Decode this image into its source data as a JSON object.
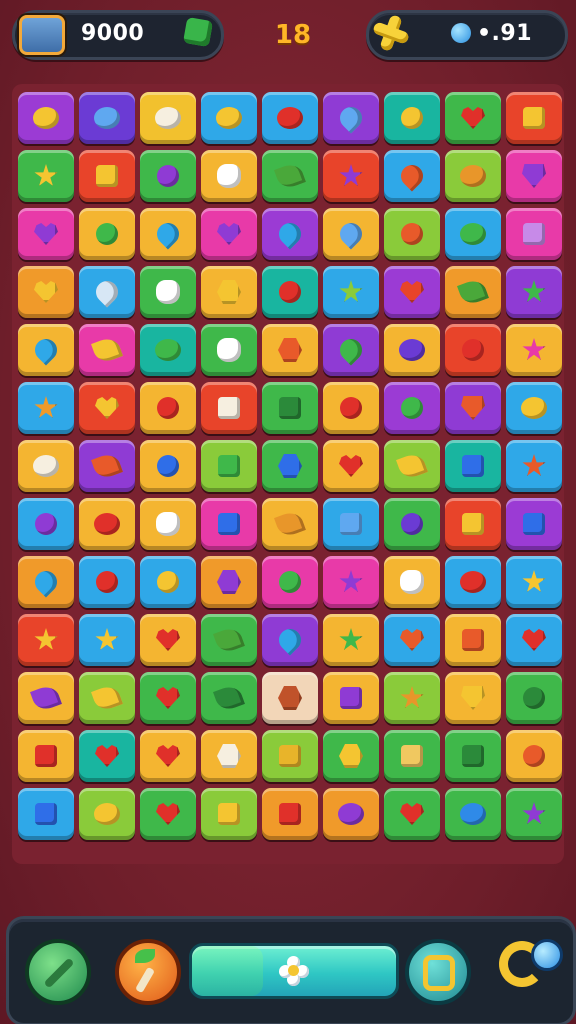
{
  "hud": {
    "score": "9000",
    "moves": "18",
    "gems": "•.91"
  },
  "board": {
    "rows": [
      [
        [
          "#9b3bd4",
          "#f4c531",
          "oval"
        ],
        [
          "#6b3bd4",
          "#5fa8f0",
          "oval"
        ],
        [
          "#f2c12e",
          "#f6efe0",
          "oval"
        ],
        [
          "#2fa8e8",
          "#f4c531",
          "oval"
        ],
        [
          "#2fa8e8",
          "#e0302a",
          "oval"
        ],
        [
          "#8f3bd4",
          "#5fa8f0",
          "drop"
        ],
        [
          "#19b5a0",
          "#f4c531",
          "round"
        ],
        [
          "#3fb84a",
          "#e0302a",
          "heart"
        ],
        [
          "#e8442a",
          "#f4c531",
          "square"
        ]
      ],
      [
        [
          "#3fb84a",
          "#f4c531",
          "star"
        ],
        [
          "#e8442a",
          "#f4c531",
          "square"
        ],
        [
          "#3fb84a",
          "#8f3bd4",
          "round"
        ],
        [
          "#f4b531",
          "#ffffff",
          "face"
        ],
        [
          "#3fb84a",
          "#4aa83a",
          "leaf"
        ],
        [
          "#e8442a",
          "#8f3bd4",
          "star"
        ],
        [
          "#2fa8e8",
          "#e85a2a",
          "drop"
        ],
        [
          "#8acb3a",
          "#e8962a",
          "oval"
        ],
        [
          "#e83aa8",
          "#8f3bd4",
          "shield"
        ]
      ],
      [
        [
          "#e83aa8",
          "#8f3bd4",
          "heart"
        ],
        [
          "#f4b531",
          "#3fb84a",
          "round"
        ],
        [
          "#f4b531",
          "#2fa8e8",
          "drop"
        ],
        [
          "#e83aa8",
          "#8f3bd4",
          "heart"
        ],
        [
          "#9b3bd4",
          "#2fa8e8",
          "drop"
        ],
        [
          "#f4b531",
          "#5fa8f0",
          "drop"
        ],
        [
          "#8acb3a",
          "#e85a2a",
          "round"
        ],
        [
          "#2fa8e8",
          "#3fb84a",
          "oval"
        ],
        [
          "#e83aa8",
          "#c78ae8",
          "square"
        ]
      ],
      [
        [
          "#f09a2a",
          "#f4c531",
          "heart"
        ],
        [
          "#2fa8e8",
          "#d7e7f5",
          "drop"
        ],
        [
          "#3fb84a",
          "#ffffff",
          "face"
        ],
        [
          "#f4b531",
          "#f4c531",
          "hex"
        ],
        [
          "#19b5a0",
          "#e0302a",
          "round"
        ],
        [
          "#2fa8e8",
          "#8acb3a",
          "star"
        ],
        [
          "#9b3bd4",
          "#e8442a",
          "heart"
        ],
        [
          "#f09a2a",
          "#4aa83a",
          "leaf"
        ],
        [
          "#8f3bd4",
          "#3fb84a",
          "star"
        ]
      ],
      [
        [
          "#f4b531",
          "#2fa8e8",
          "drop"
        ],
        [
          "#e83aa8",
          "#f4c531",
          "leaf"
        ],
        [
          "#19b5a0",
          "#3fb84a",
          "oval"
        ],
        [
          "#3fb84a",
          "#ffffff",
          "face"
        ],
        [
          "#f4b531",
          "#e85a2a",
          "hex"
        ],
        [
          "#8f3bd4",
          "#3fb84a",
          "drop"
        ],
        [
          "#f4b531",
          "#6b3bd4",
          "oval"
        ],
        [
          "#e8442a",
          "#e0302a",
          "round"
        ],
        [
          "#f4b531",
          "#e83aa8",
          "star"
        ]
      ],
      [
        [
          "#2fa8e8",
          "#f09a2a",
          "star"
        ],
        [
          "#e8442a",
          "#f4c531",
          "heart"
        ],
        [
          "#f4b531",
          "#e0302a",
          "round"
        ],
        [
          "#e8442a",
          "#f6efe0",
          "square"
        ],
        [
          "#3fb84a",
          "#2b8a3a",
          "square"
        ],
        [
          "#f4b531",
          "#e0302a",
          "round"
        ],
        [
          "#9b3bd4",
          "#3fb84a",
          "round"
        ],
        [
          "#8f3bd4",
          "#e85a2a",
          "shield"
        ],
        [
          "#2fa8e8",
          "#f4c531",
          "oval"
        ]
      ],
      [
        [
          "#f4b531",
          "#f6efe0",
          "oval"
        ],
        [
          "#8f3bd4",
          "#e85a2a",
          "leaf"
        ],
        [
          "#f4b531",
          "#2f6ee8",
          "round"
        ],
        [
          "#8acb3a",
          "#3fb84a",
          "square"
        ],
        [
          "#3fb84a",
          "#2f6ee8",
          "hex"
        ],
        [
          "#f4b531",
          "#e0302a",
          "heart"
        ],
        [
          "#8acb3a",
          "#f4c531",
          "leaf"
        ],
        [
          "#19b5a0",
          "#2f6ee8",
          "square"
        ],
        [
          "#2fa8e8",
          "#e85a2a",
          "star"
        ]
      ],
      [
        [
          "#2fa8e8",
          "#8f3bd4",
          "round"
        ],
        [
          "#f4b531",
          "#e0302a",
          "oval"
        ],
        [
          "#f4b531",
          "#ffffff",
          "face"
        ],
        [
          "#e83aa8",
          "#2f6ee8",
          "square"
        ],
        [
          "#f4b531",
          "#e8962a",
          "leaf"
        ],
        [
          "#2fa8e8",
          "#5fa8f0",
          "square"
        ],
        [
          "#3fb84a",
          "#6b3bd4",
          "round"
        ],
        [
          "#e8442a",
          "#f4c531",
          "square"
        ],
        [
          "#9b3bd4",
          "#2f6ee8",
          "square"
        ]
      ],
      [
        [
          "#f09a2a",
          "#2fa8e8",
          "drop"
        ],
        [
          "#2fa8e8",
          "#e0302a",
          "round"
        ],
        [
          "#2fa8e8",
          "#f4c531",
          "round"
        ],
        [
          "#f09a2a",
          "#8f3bd4",
          "hex"
        ],
        [
          "#e83aa8",
          "#3fb84a",
          "round"
        ],
        [
          "#e83aa8",
          "#8f3bd4",
          "star"
        ],
        [
          "#f4b531",
          "#ffffff",
          "face"
        ],
        [
          "#2fa8e8",
          "#e0302a",
          "oval"
        ],
        [
          "#2fa8e8",
          "#f4c531",
          "star"
        ]
      ],
      [
        [
          "#e8442a",
          "#f4c531",
          "star"
        ],
        [
          "#2fa8e8",
          "#f4c531",
          "star"
        ],
        [
          "#f4b531",
          "#e0302a",
          "heart"
        ],
        [
          "#3fb84a",
          "#4aa83a",
          "leaf"
        ],
        [
          "#8f3bd4",
          "#2fa8e8",
          "drop"
        ],
        [
          "#f4b531",
          "#3fb84a",
          "star"
        ],
        [
          "#2fa8e8",
          "#e85a2a",
          "heart"
        ],
        [
          "#f4b531",
          "#e85a2a",
          "square"
        ],
        [
          "#2fa8e8",
          "#e0302a",
          "heart"
        ]
      ],
      [
        [
          "#f4b531",
          "#8f3bd4",
          "leaf"
        ],
        [
          "#8acb3a",
          "#f4c531",
          "leaf"
        ],
        [
          "#3fb84a",
          "#e0302a",
          "heart"
        ],
        [
          "#3fb84a",
          "#2b8a3a",
          "leaf"
        ],
        [
          "#f2d6b8",
          "#c0522a",
          "hex"
        ],
        [
          "#f4b531",
          "#8f3bd4",
          "square"
        ],
        [
          "#8acb3a",
          "#e8962a",
          "star"
        ],
        [
          "#f4b531",
          "#f4c531",
          "shield"
        ],
        [
          "#3fb84a",
          "#2b8a3a",
          "round"
        ]
      ],
      [
        [
          "#f4b531",
          "#e0302a",
          "square"
        ],
        [
          "#19b5a0",
          "#e0302a",
          "heart"
        ],
        [
          "#f4b531",
          "#e0302a",
          "heart"
        ],
        [
          "#f4b531",
          "#f6efe0",
          "hex"
        ],
        [
          "#8acb3a",
          "#e8b42a",
          "square"
        ],
        [
          "#3fb84a",
          "#f4c531",
          "hex"
        ],
        [
          "#3fb84a",
          "#f0c860",
          "square"
        ],
        [
          "#3fb84a",
          "#2b8a3a",
          "square"
        ],
        [
          "#f4b531",
          "#e85a2a",
          "round"
        ]
      ],
      [
        [
          "#2fa8e8",
          "#2f6ee8",
          "square"
        ],
        [
          "#8acb3a",
          "#f4c531",
          "oval"
        ],
        [
          "#3fb84a",
          "#e0302a",
          "heart"
        ],
        [
          "#8acb3a",
          "#f4c531",
          "square"
        ],
        [
          "#f09a2a",
          "#e0302a",
          "square"
        ],
        [
          "#f09a2a",
          "#8f3bd4",
          "oval"
        ],
        [
          "#3fb84a",
          "#e0302a",
          "heart"
        ],
        [
          "#3fb84a",
          "#2f8ae8",
          "oval"
        ],
        [
          "#3fb84a",
          "#8f3bd4",
          "star"
        ]
      ]
    ]
  },
  "bottom": {
    "progress": 0.35
  }
}
